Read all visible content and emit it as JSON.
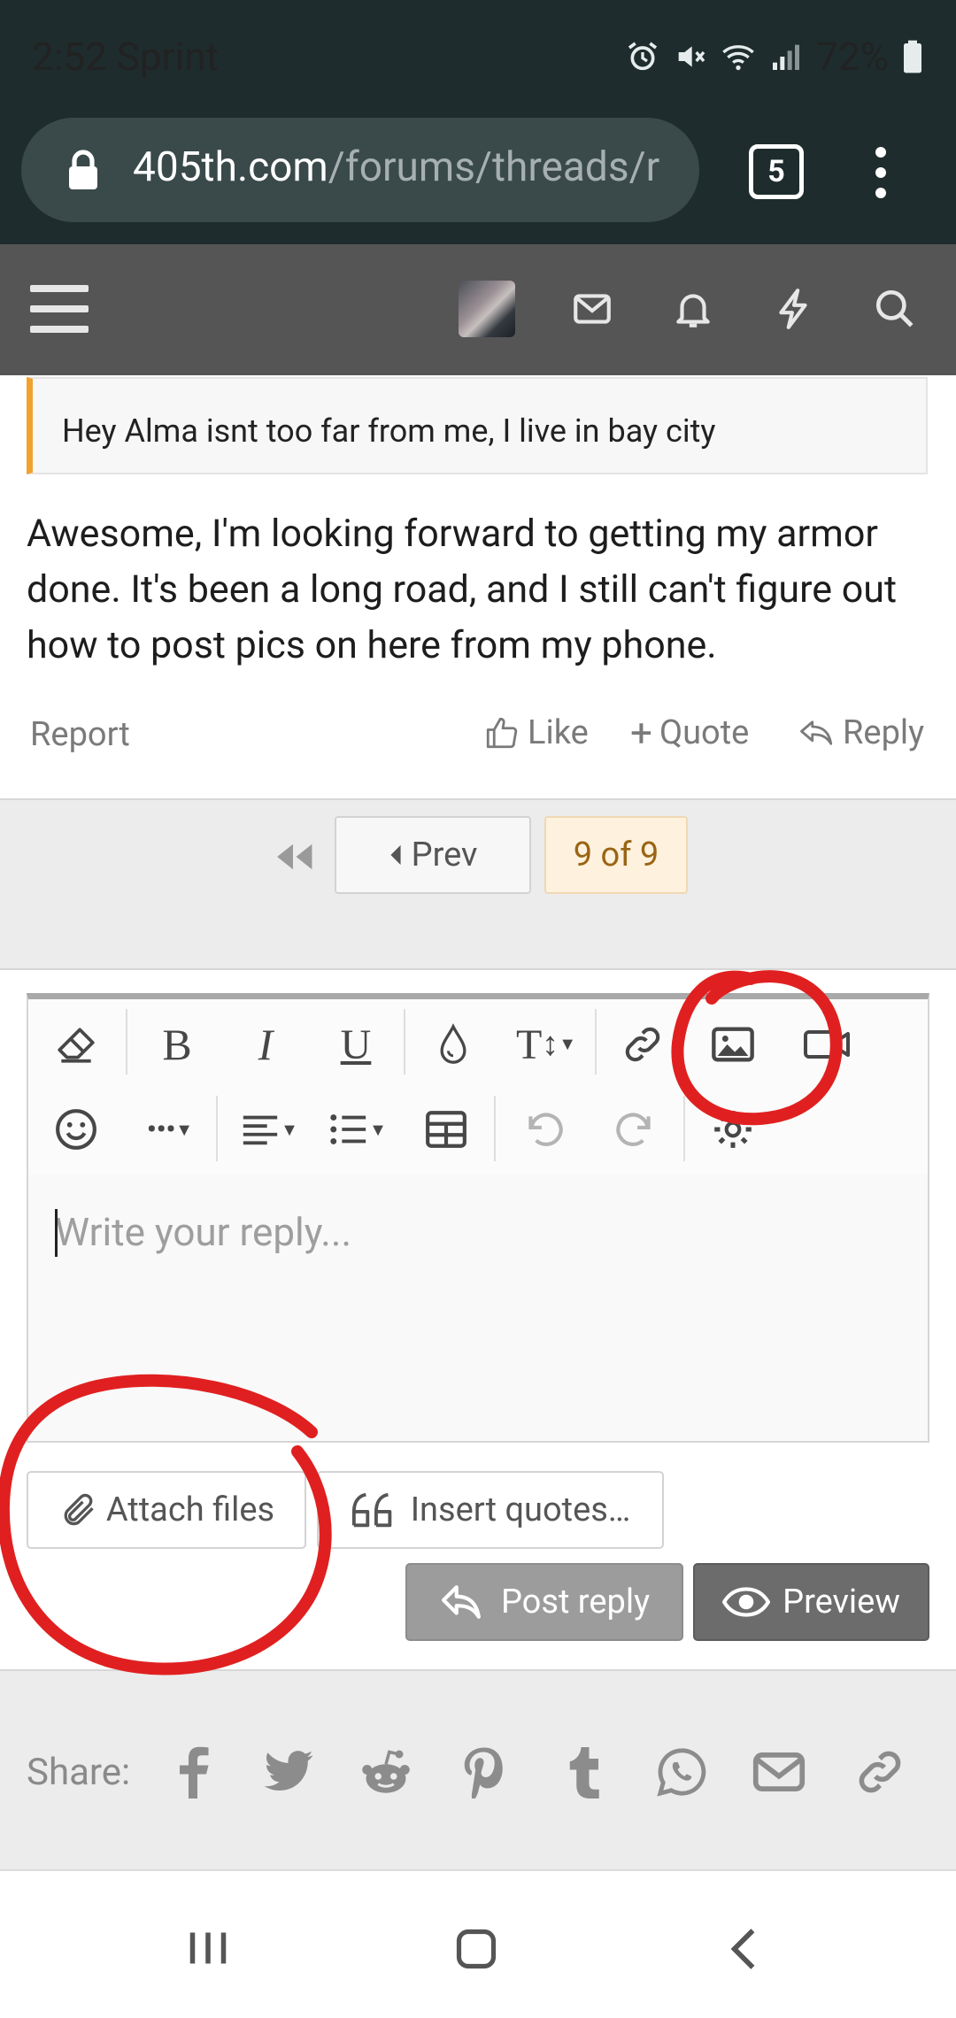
{
  "status_bar": {
    "time_carrier": "2:52 Sprint",
    "battery": "72%"
  },
  "browser": {
    "url_host": "405th.com",
    "url_path": "/forums/threads/r",
    "tab_count": "5"
  },
  "post": {
    "quote_text": "Hey Alma isnt too far from me, I live in bay city",
    "body": "Awesome, I'm looking forward to getting my armor done. It's been a long road, and I still can't figure out how to post pics on here from my phone.",
    "report_label": "Report",
    "like_label": "Like",
    "quote_label": "Quote",
    "reply_label": "Reply"
  },
  "pagination": {
    "prev_label": "Prev",
    "current": "9 of 9"
  },
  "editor": {
    "placeholder": "Write your reply...",
    "toolbar_icons": [
      "eraser-icon",
      "bold-icon",
      "italic-icon",
      "underline-icon",
      "text-color-icon",
      "font-size-icon",
      "link-icon",
      "image-icon",
      "video-icon",
      "smilie-icon",
      "more-icon",
      "align-icon",
      "list-icon",
      "table-icon",
      "undo-icon",
      "redo-icon",
      "settings-icon"
    ],
    "attach_label": "Attach files",
    "insert_quotes_label": "Insert quotes…",
    "post_reply_label": "Post reply",
    "preview_label": "Preview"
  },
  "share": {
    "label": "Share:",
    "icons": [
      "facebook-icon",
      "twitter-icon",
      "reddit-icon",
      "pinterest-icon",
      "tumblr-icon",
      "whatsapp-icon",
      "email-icon",
      "link-icon"
    ]
  },
  "colors": {
    "status_bg": "#1e2c2d",
    "forum_nav_bg": "#555555",
    "quote_accent": "#f1a22c",
    "current_page_bg": "#fef1dd",
    "annotation_red": "#e02020"
  }
}
